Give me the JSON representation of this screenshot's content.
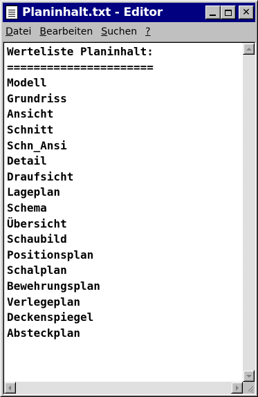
{
  "window": {
    "title": "Planinhalt.txt - Editor",
    "app_icon": "notepad-icon",
    "controls": {
      "minimize_icon": "minimize-icon",
      "maximize_icon": "maximize-icon",
      "close_icon": "close-icon"
    },
    "titlebar_color": "#000080"
  },
  "menu": {
    "items": [
      {
        "mnemonic": "D",
        "rest": "atei"
      },
      {
        "mnemonic": "B",
        "rest": "earbeiten"
      },
      {
        "mnemonic": "S",
        "rest": "uchen"
      },
      {
        "mnemonic": "?",
        "rest": ""
      }
    ]
  },
  "editor": {
    "lines": [
      "Werteliste Planinhalt:",
      "======================",
      "Modell",
      "Grundriss",
      "Ansicht",
      "Schnitt",
      "Schn_Ansi",
      "Detail",
      "Draufsicht",
      "Lageplan",
      "Schema",
      "Übersicht",
      "Schaubild",
      "Positionsplan",
      "Schalplan",
      "Bewehrungsplan",
      "Verlegeplan",
      "Deckenspiegel",
      "Absteckplan"
    ]
  }
}
